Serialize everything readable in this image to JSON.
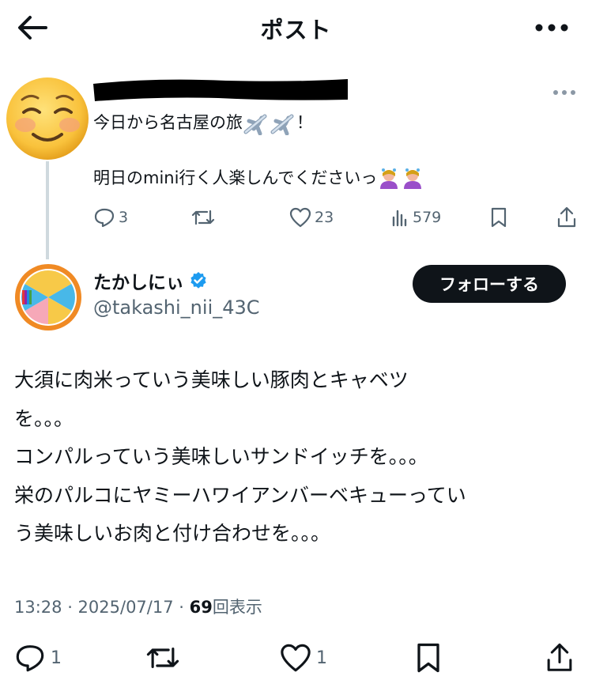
{
  "header": {
    "title": "ポスト"
  },
  "parent_post": {
    "text_line1": "今日から名古屋の旅",
    "text_line1_suffix": "！",
    "text_line2": "明日のmini行く人楽しんでくださいっ",
    "actions": {
      "reply_count": "3",
      "repost_count": "",
      "like_count": "23",
      "views_count": "579"
    }
  },
  "author": {
    "name": "たかしにぃ",
    "handle": "@takashi_nii_43C",
    "follow_label": "フォローする"
  },
  "post": {
    "lines": [
      "大須に肉米っていう美味しい豚肉とキャベツ",
      "を。。。",
      "コンパルっていう美味しいサンドイッチを。。。",
      "栄のパルコにヤミーハワイアンバーベキューってい",
      "う美味しいお肉と付け合わせを。。。"
    ],
    "time": "13:28 · 2025/07/17 · ",
    "views_number": "69",
    "views_label": "回表示"
  },
  "actions": {
    "reply_count": "1",
    "repost_count": "",
    "like_count": "1"
  },
  "colors": {
    "text": "#0f1419",
    "muted": "#536471",
    "verified": "#1d9bf0",
    "follow_bg": "#0f1419",
    "thread_line": "#cfd9de"
  }
}
